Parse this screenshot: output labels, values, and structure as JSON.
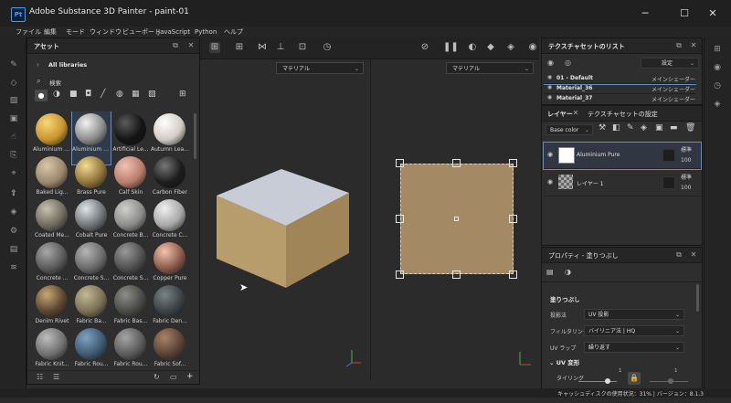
{
  "app": {
    "title": "Adobe Substance 3D Painter - paint-01",
    "icon_label": "Pt",
    "window_buttons": {
      "minimize": "─",
      "maximize": "☐",
      "close": "✕"
    }
  },
  "menu": [
    "ファイル",
    "編集",
    "モード",
    "ウィンドウ",
    "ビューポート",
    "JavaScript",
    "Python",
    "ヘルプ"
  ],
  "assets": {
    "title": "アセット",
    "library": "All libraries",
    "search_placeholder": "検索",
    "items": [
      {
        "label": "Aluminium Ar...",
        "color": "#c9952e",
        "light": "#f5d77a"
      },
      {
        "label": "Aluminium Pure",
        "color": "#8c8c8c",
        "light": "#f2f2f2"
      },
      {
        "label": "Artificial Le...",
        "color": "#141414",
        "light": "#5a5a5a"
      },
      {
        "label": "Autumn Lea...",
        "color": "#d1ccc4",
        "light": "#ffffff"
      },
      {
        "label": "Baked Lig...",
        "color": "#9b876c",
        "light": "#dac7ab"
      },
      {
        "label": "Brass Pure",
        "color": "#8f7438",
        "light": "#f3dc96"
      },
      {
        "label": "Calf Skin",
        "color": "#b97d6b",
        "light": "#f0c2b2"
      },
      {
        "label": "Carbon Fiber",
        "color": "#1c1c1c",
        "light": "#777777"
      },
      {
        "label": "Coated Me...",
        "color": "#6e6b5e",
        "light": "#c7c2ae"
      },
      {
        "label": "Cobalt Pure",
        "color": "#6f7478",
        "light": "#e1e5e8"
      },
      {
        "label": "Concrete B...",
        "color": "#8c8c8a",
        "light": "#cfcfcc"
      },
      {
        "label": "Concrete C...",
        "color": "#a7a7a7",
        "light": "#f0f0f0"
      },
      {
        "label": "Concrete ...",
        "color": "#5a5a5a",
        "light": "#a8a8a8"
      },
      {
        "label": "Concrete S...",
        "color": "#6a6a6a",
        "light": "#b5b5b5"
      },
      {
        "label": "Concrete S...",
        "color": "#4f4f4f",
        "light": "#999999"
      },
      {
        "label": "Copper Pure",
        "color": "#8a5a4a",
        "light": "#f4c4ae"
      },
      {
        "label": "Denim Rivet",
        "color": "#5a4630",
        "light": "#c9a877"
      },
      {
        "label": "Fabric Ba...",
        "color": "#7a7055",
        "light": "#c4b995"
      },
      {
        "label": "Fabric Bas...",
        "color": "#4a4a48",
        "light": "#8d8d89"
      },
      {
        "label": "Fabric Den...",
        "color": "#3c4244",
        "light": "#7b8386"
      },
      {
        "label": "Fabric Knit...",
        "color": "#707070",
        "light": "#bdbdbd"
      },
      {
        "label": "Fabric Rou...",
        "color": "#3e5a72",
        "light": "#7fa1be"
      },
      {
        "label": "Fabric Rou...",
        "color": "#5b5b5b",
        "light": "#a5a5a5"
      },
      {
        "label": "Fabric Sof...",
        "color": "#5a4234",
        "light": "#a9836b"
      }
    ]
  },
  "viewport": {
    "left_dropdown": "マテリアル",
    "right_dropdown": "マテリアル",
    "uv_color": "#a38a64",
    "box_top": "#c8ccd6",
    "box_side_left": "#b79d6b",
    "box_side_right": "#9f8557"
  },
  "texture_sets": {
    "title": "テクスチャセットのリスト",
    "settings_label": "設定",
    "rows": [
      {
        "name": "01 - Default",
        "shader": "メインシェーダー"
      },
      {
        "name": "Material_36",
        "shader": "メインシェーダー"
      },
      {
        "name": "Material_37",
        "shader": "メインシェーダー"
      }
    ]
  },
  "layers": {
    "tab_layers": "レイヤー",
    "tab_settings": "テクスチャセットの設定",
    "channel": "Base color",
    "items": [
      {
        "name": "Aluminium Pure",
        "blend": "標準",
        "opacity": "100"
      },
      {
        "name": "レイヤー 1",
        "blend": "標準",
        "opacity": "100"
      }
    ]
  },
  "properties": {
    "title": "プロパティ - 塗りつぶし",
    "section": "塗りつぶし",
    "fields": [
      {
        "label": "投影法",
        "value": "UV 投影"
      },
      {
        "label": "フィルタリング",
        "value": "バイリニア法 | HQ"
      },
      {
        "label": "UV ラップ",
        "value": "繰り返す"
      }
    ],
    "uv_transform": "UV 変形",
    "tiling_label": "タイリング",
    "tiling_value": "1"
  },
  "status": {
    "text": "キャッシュディスクの使用状況：31% | バージョン：8.1.3"
  }
}
